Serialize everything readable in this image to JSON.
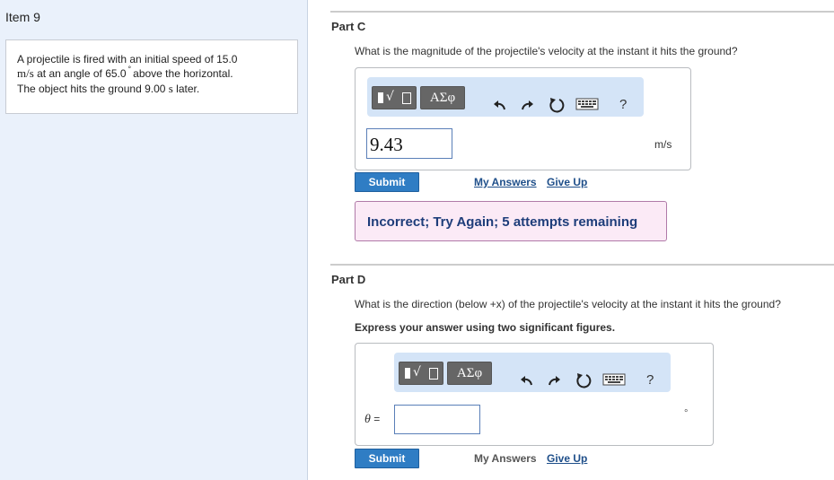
{
  "item": {
    "title": "Item 9"
  },
  "problem": {
    "line1": "A projectile is fired with an initial speed of 15.0",
    "line2_unit": "m/s",
    "line2_text": " at an angle of 65.0",
    "line2_degree": "°",
    "line2_after": "above the horizontal.",
    "line3_pre": "The object hits the ground 9.00 ",
    "line3_unit": "s",
    "line3_post": " later."
  },
  "partC": {
    "title": "Part C",
    "question": "What is the magnitude of the projectile's velocity at the instant it hits the ground?",
    "toolbar": {
      "symbols_label": "ΑΣφ",
      "help_label": "?"
    },
    "answer_value": "9.43",
    "unit": "m/s",
    "submit_label": "Submit",
    "my_answers_label": "My Answers",
    "give_up_label": "Give Up",
    "feedback": "Incorrect; Try Again; 5 attempts remaining"
  },
  "partD": {
    "title": "Part D",
    "question": "What is the direction (below +x) of the projectile's velocity at the instant it hits the ground?",
    "instruction": "Express your answer using two significant figures.",
    "toolbar": {
      "symbols_label": "ΑΣφ",
      "help_label": "?"
    },
    "variable": "θ",
    "equals": " =",
    "answer_value": "",
    "unit": "°",
    "submit_label": "Submit",
    "my_answers_label": "My Answers",
    "give_up_label": "Give Up"
  }
}
